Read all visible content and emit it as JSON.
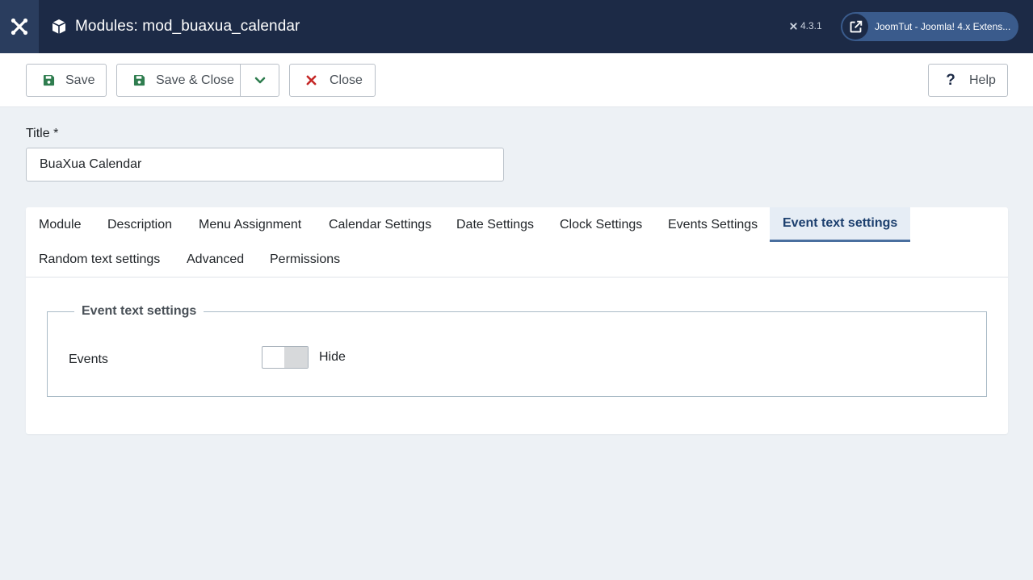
{
  "header": {
    "title": "Modules: mod_buaxua_calendar",
    "version": "4.3.1",
    "site_link_label": "JoomTut - Joomla! 4.x Extens..."
  },
  "toolbar": {
    "save_label": "Save",
    "save_close_label": "Save & Close",
    "close_label": "Close",
    "help_label": "Help"
  },
  "form": {
    "title_label": "Title *",
    "title_value": "BuaXua Calendar"
  },
  "tabs": [
    {
      "label": "Module"
    },
    {
      "label": "Description"
    },
    {
      "label": "Menu Assignment"
    },
    {
      "label": "Calendar Settings"
    },
    {
      "label": "Date Settings"
    },
    {
      "label": "Clock Settings"
    },
    {
      "label": "Events Settings"
    },
    {
      "label": "Event text settings"
    },
    {
      "label": "Random text settings"
    },
    {
      "label": "Advanced"
    },
    {
      "label": "Permissions"
    }
  ],
  "active_tab": "Event text settings",
  "panel": {
    "legend": "Event text settings",
    "events_label": "Events",
    "events_state": "Hide"
  },
  "colors": {
    "header_bg": "#1c2a46",
    "active_tab_text": "#1c3f6e",
    "save_icon": "#2f7d4f",
    "close_icon": "#c52827"
  },
  "icons": {
    "logo": "joomla-logo-icon",
    "page": "cube-icon",
    "save": "floppy-disk-icon",
    "dropdown": "chevron-down-icon",
    "close": "x-icon",
    "help": "question-icon",
    "external": "external-link-icon"
  }
}
